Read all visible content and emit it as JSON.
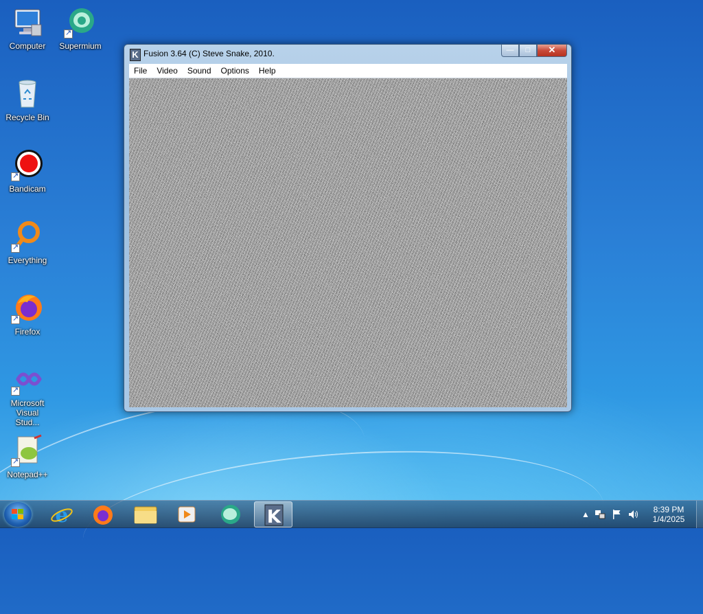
{
  "desktop": {
    "icons": [
      {
        "label": "Computer"
      },
      {
        "label": "Supermium"
      },
      {
        "label": "Recycle Bin"
      },
      {
        "label": "Bandicam"
      },
      {
        "label": "Everything"
      },
      {
        "label": "Firefox"
      },
      {
        "label": "Microsoft Visual Stud..."
      },
      {
        "label": "Notepad++"
      }
    ]
  },
  "window": {
    "title": "Fusion 3.64 (C) Steve Snake, 2010.",
    "logo_letter": "K",
    "menu": [
      "File",
      "Video",
      "Sound",
      "Options",
      "Help"
    ],
    "controls": {
      "minimize": "—",
      "maximize": "□",
      "close": "✕"
    }
  },
  "taskbar": {
    "pinned": [
      "internet-explorer",
      "firefox",
      "file-explorer",
      "media-player",
      "supermium",
      "fusion"
    ],
    "active": "fusion",
    "clock": {
      "time": "8:39 PM",
      "date": "1/4/2025"
    },
    "tray_icons": [
      "show-hidden-icons",
      "network-icon",
      "action-center-flag-icon",
      "volume-icon"
    ]
  },
  "colors": {
    "accent": "#2a7fd6",
    "window_frame": "#a9c8e6"
  }
}
